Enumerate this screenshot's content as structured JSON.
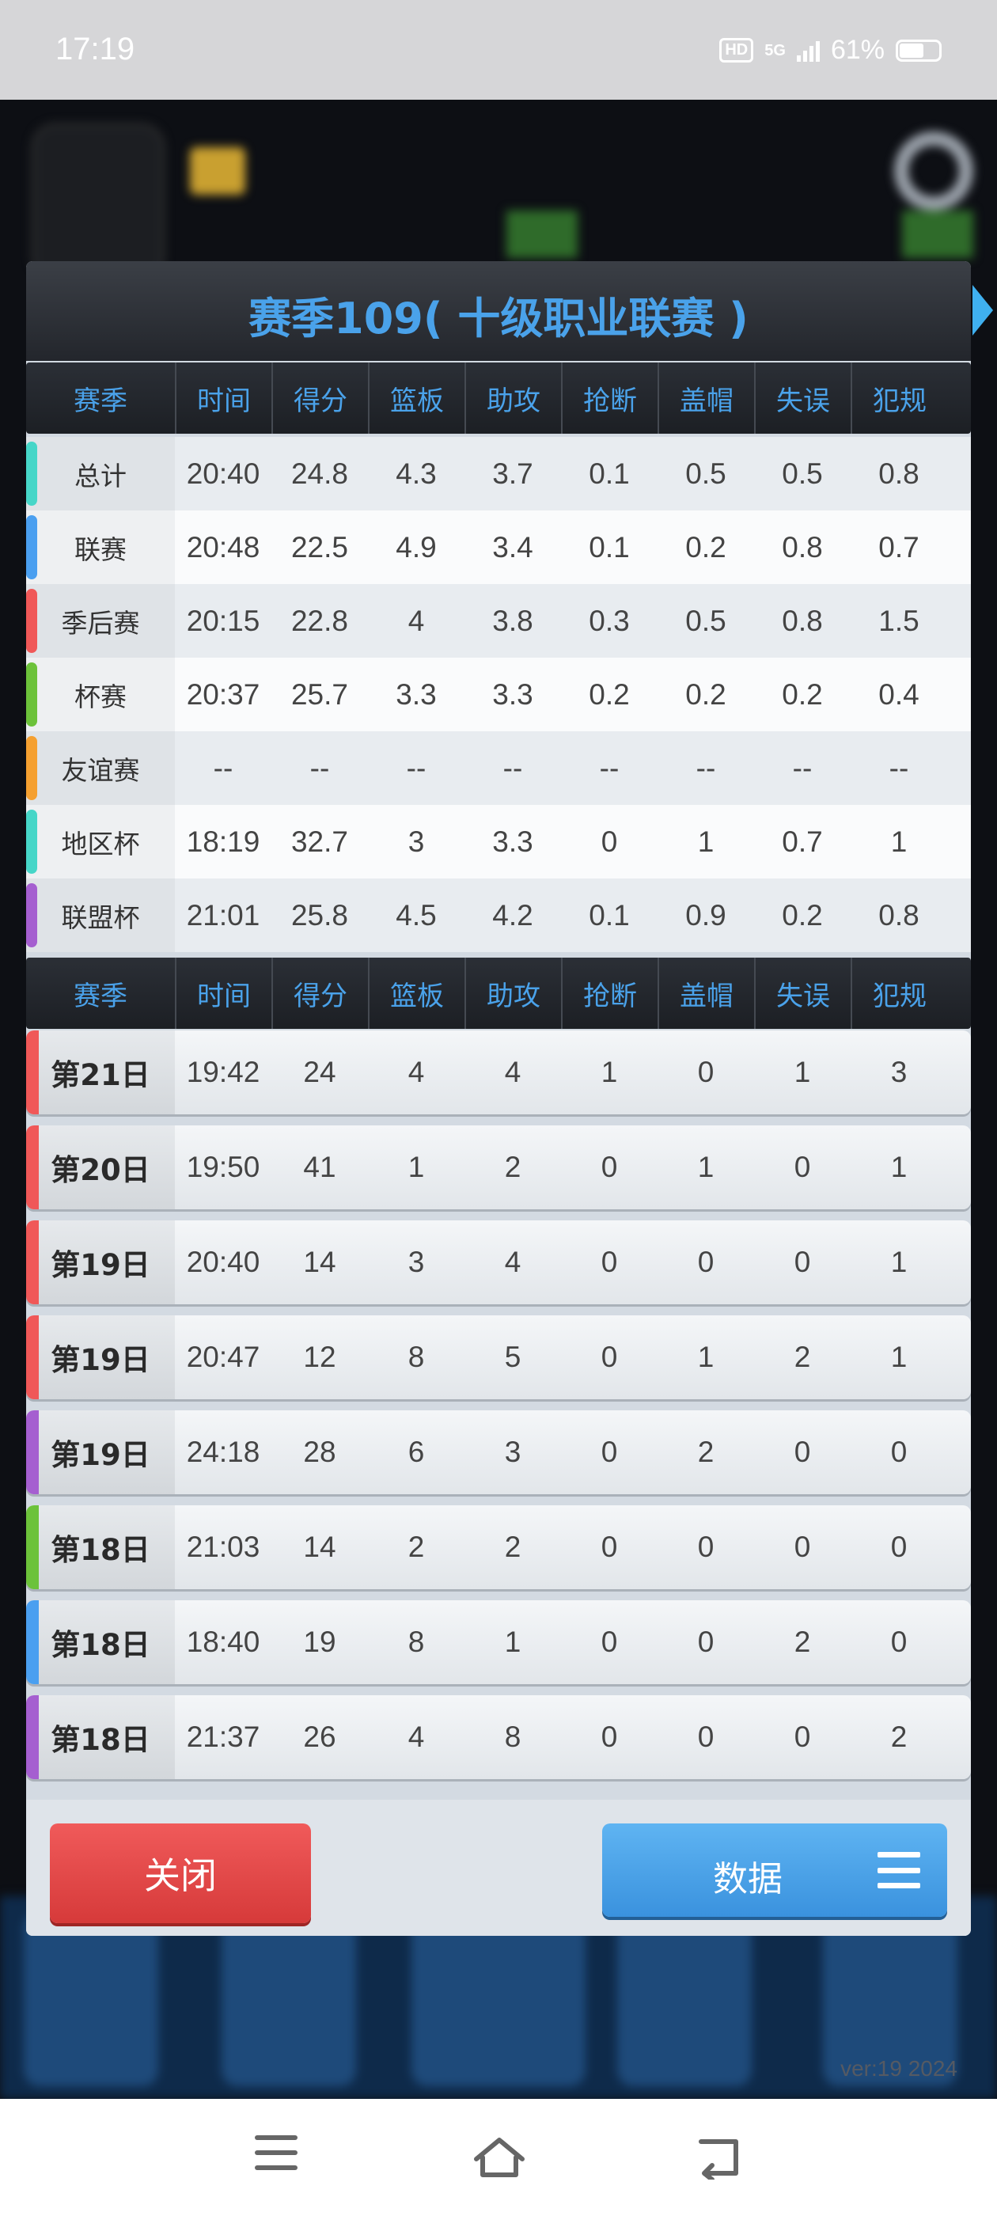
{
  "status_bar": {
    "time": "17:19",
    "hd": "HD",
    "network": "5G",
    "battery": "61%"
  },
  "dialog": {
    "title": "赛季109( 十级职业联赛 )",
    "columns": [
      "赛季",
      "时间",
      "得分",
      "篮板",
      "助攻",
      "抢断",
      "盖帽",
      "失误",
      "犯规"
    ],
    "aggregate_rows": [
      {
        "label": "总计",
        "color": "#46d6c8",
        "values": [
          "20:40",
          "24.8",
          "4.3",
          "3.7",
          "0.1",
          "0.5",
          "0.5",
          "0.8"
        ]
      },
      {
        "label": "联赛",
        "color": "#4a9ff0",
        "values": [
          "20:48",
          "22.5",
          "4.9",
          "3.4",
          "0.1",
          "0.2",
          "0.8",
          "0.7"
        ]
      },
      {
        "label": "季后赛",
        "color": "#f05858",
        "values": [
          "20:15",
          "22.8",
          "4",
          "3.8",
          "0.3",
          "0.5",
          "0.8",
          "1.5"
        ]
      },
      {
        "label": "杯赛",
        "color": "#6cc23a",
        "values": [
          "20:37",
          "25.7",
          "3.3",
          "3.3",
          "0.2",
          "0.2",
          "0.2",
          "0.4"
        ]
      },
      {
        "label": "友谊赛",
        "color": "#f5a030",
        "values": [
          "--",
          "--",
          "--",
          "--",
          "--",
          "--",
          "--",
          "--"
        ]
      },
      {
        "label": "地区杯",
        "color": "#46d6c8",
        "values": [
          "18:19",
          "32.7",
          "3",
          "3.3",
          "0",
          "1",
          "0.7",
          "1"
        ]
      },
      {
        "label": "联盟杯",
        "color": "#a55fd0",
        "values": [
          "21:01",
          "25.8",
          "4.5",
          "4.2",
          "0.1",
          "0.9",
          "0.2",
          "0.8"
        ]
      }
    ],
    "game_rows": [
      {
        "label": "第21日",
        "color": "#f05858",
        "values": [
          "19:42",
          "24",
          "4",
          "4",
          "1",
          "0",
          "1",
          "3"
        ]
      },
      {
        "label": "第20日",
        "color": "#f05858",
        "values": [
          "19:50",
          "41",
          "1",
          "2",
          "0",
          "1",
          "0",
          "1"
        ]
      },
      {
        "label": "第19日",
        "color": "#f05858",
        "values": [
          "20:40",
          "14",
          "3",
          "4",
          "0",
          "0",
          "0",
          "1"
        ]
      },
      {
        "label": "第19日",
        "color": "#f05858",
        "values": [
          "20:47",
          "12",
          "8",
          "5",
          "0",
          "1",
          "2",
          "1"
        ]
      },
      {
        "label": "第19日",
        "color": "#a55fd0",
        "values": [
          "24:18",
          "28",
          "6",
          "3",
          "0",
          "2",
          "0",
          "0"
        ]
      },
      {
        "label": "第18日",
        "color": "#6cc23a",
        "values": [
          "21:03",
          "14",
          "2",
          "2",
          "0",
          "0",
          "0",
          "0"
        ]
      },
      {
        "label": "第18日",
        "color": "#4a9ff0",
        "values": [
          "18:40",
          "19",
          "8",
          "1",
          "0",
          "0",
          "2",
          "0"
        ]
      },
      {
        "label": "第18日",
        "color": "#a55fd0",
        "values": [
          "21:37",
          "26",
          "4",
          "8",
          "0",
          "0",
          "0",
          "2"
        ]
      }
    ],
    "close_label": "关闭",
    "data_label": "数据"
  },
  "version": "ver:19  2024"
}
